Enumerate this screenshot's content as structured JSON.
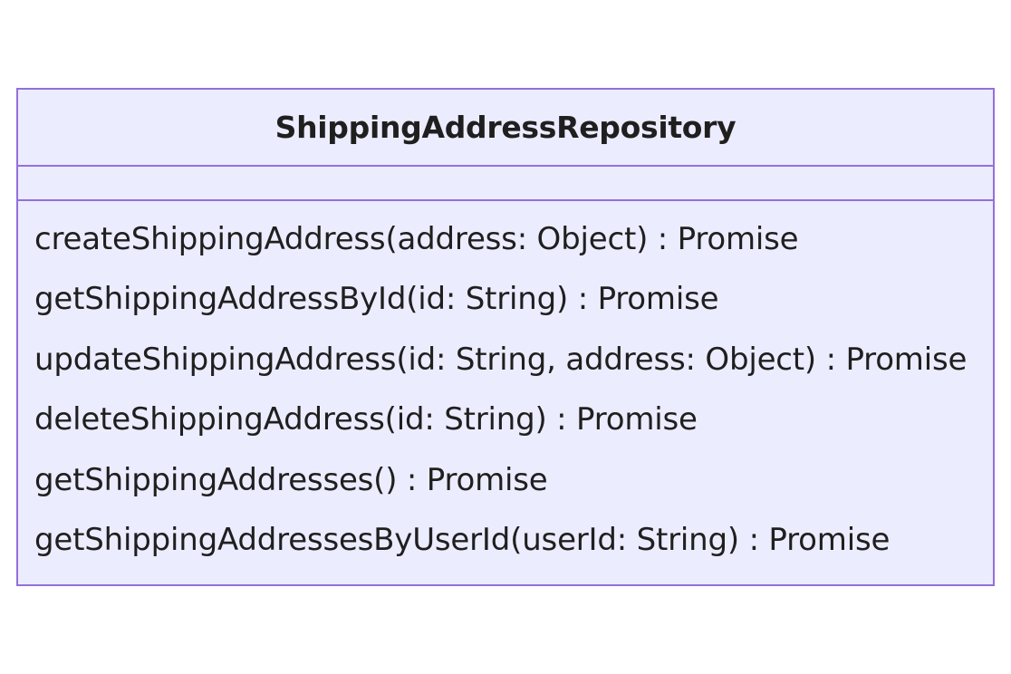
{
  "diagram": {
    "type": "uml-class",
    "class": {
      "name": "ShippingAddressRepository",
      "attributes": [],
      "methods": [
        "createShippingAddress(address: Object) : Promise",
        "getShippingAddressById(id: String) : Promise",
        "updateShippingAddress(id: String, address: Object) : Promise",
        "deleteShippingAddress(id: String) : Promise",
        "getShippingAddresses() : Promise",
        "getShippingAddressesByUserId(userId: String) : Promise"
      ]
    },
    "colors": {
      "fill": "#ececff",
      "border": "#9370db",
      "text": "#1f1f1f"
    }
  }
}
